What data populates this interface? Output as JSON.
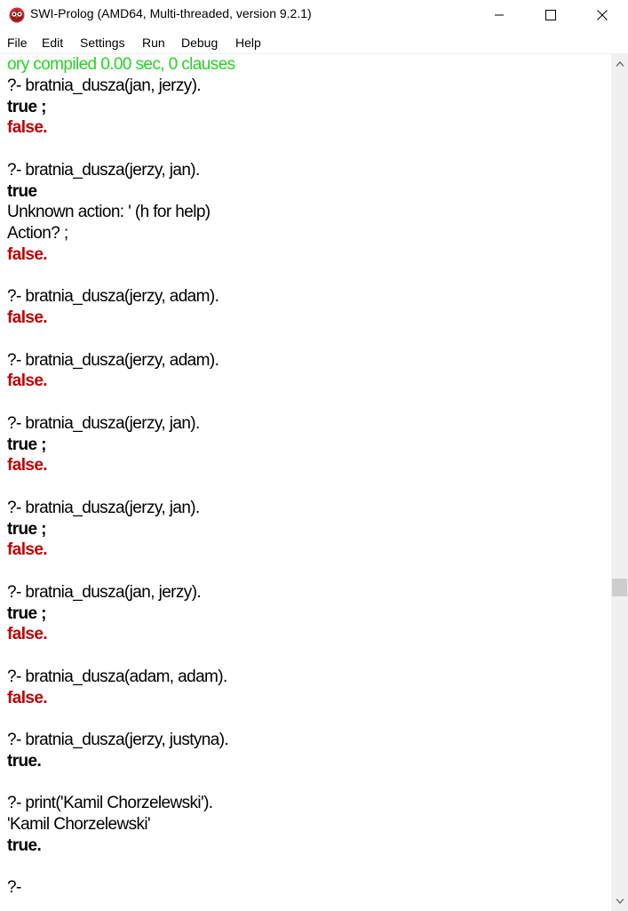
{
  "window": {
    "title": "SWI-Prolog (AMD64, Multi-threaded, version 9.2.1)"
  },
  "menu": {
    "items": [
      "File",
      "Edit",
      "Settings",
      "Run",
      "Debug",
      "Help"
    ]
  },
  "console": {
    "lines": [
      {
        "text": "ory compiled 0.00 sec, 0 clauses",
        "style": "green"
      },
      {
        "text": "?- bratnia_dusza(jan, jerzy).",
        "style": "normal"
      },
      {
        "text": "true ;",
        "style": "true"
      },
      {
        "text": "false.",
        "style": "false"
      },
      {
        "text": "",
        "style": "normal"
      },
      {
        "text": "?- bratnia_dusza(jerzy, jan).",
        "style": "normal"
      },
      {
        "text": "true",
        "style": "true"
      },
      {
        "text": "Unknown action: ' (h for help)",
        "style": "normal"
      },
      {
        "text": "Action? ;",
        "style": "normal"
      },
      {
        "text": "false.",
        "style": "false"
      },
      {
        "text": "",
        "style": "normal"
      },
      {
        "text": "?- bratnia_dusza(jerzy, adam).",
        "style": "normal"
      },
      {
        "text": "false.",
        "style": "false"
      },
      {
        "text": "",
        "style": "normal"
      },
      {
        "text": "?- bratnia_dusza(jerzy, adam).",
        "style": "normal"
      },
      {
        "text": "false.",
        "style": "false"
      },
      {
        "text": "",
        "style": "normal"
      },
      {
        "text": "?- bratnia_dusza(jerzy, jan).",
        "style": "normal"
      },
      {
        "text": "true ;",
        "style": "true"
      },
      {
        "text": "false.",
        "style": "false"
      },
      {
        "text": "",
        "style": "normal"
      },
      {
        "text": "?- bratnia_dusza(jerzy, jan).",
        "style": "normal"
      },
      {
        "text": "true ;",
        "style": "true"
      },
      {
        "text": "false.",
        "style": "false"
      },
      {
        "text": "",
        "style": "normal"
      },
      {
        "text": "?- bratnia_dusza(jan, jerzy).",
        "style": "normal"
      },
      {
        "text": "true ;",
        "style": "true"
      },
      {
        "text": "false.",
        "style": "false"
      },
      {
        "text": "",
        "style": "normal"
      },
      {
        "text": "?- bratnia_dusza(adam, adam).",
        "style": "normal"
      },
      {
        "text": "false.",
        "style": "false"
      },
      {
        "text": "",
        "style": "normal"
      },
      {
        "text": "?- bratnia_dusza(jerzy, justyna).",
        "style": "normal"
      },
      {
        "text": "true.",
        "style": "true"
      },
      {
        "text": "",
        "style": "normal"
      },
      {
        "text": "?- print('Kamil Chorzelewski').",
        "style": "normal"
      },
      {
        "text": "'Kamil Chorzelewski'",
        "style": "normal"
      },
      {
        "text": "true.",
        "style": "true"
      },
      {
        "text": "",
        "style": "normal"
      },
      {
        "text": "?-",
        "style": "normal"
      }
    ]
  },
  "scrollbar": {
    "position_fraction": 0.63
  },
  "colors": {
    "green": "#27d327",
    "red": "#c00000",
    "scrollbar_track": "#f0f0f0",
    "scrollbar_thumb": "#cdcdcd"
  },
  "icons": {
    "app": "swi-prolog-owl-icon",
    "minimize": "minimize-icon",
    "maximize": "maximize-icon",
    "close": "close-icon",
    "scroll_up": "chevron-up-icon",
    "scroll_down": "chevron-down-icon"
  }
}
